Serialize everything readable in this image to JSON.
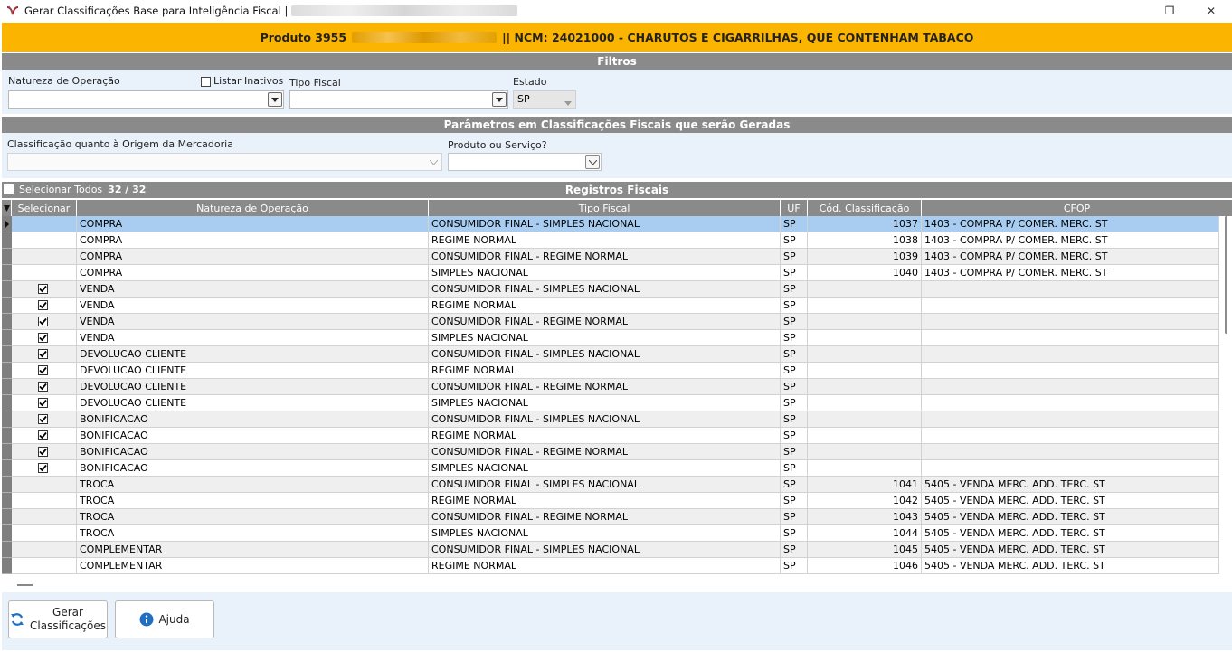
{
  "window": {
    "title": "Gerar Classificações Base para Inteligência Fiscal |",
    "maximize_glyph": "❐",
    "close_glyph": "✕"
  },
  "banner": {
    "product": "Produto 3955",
    "ncm": "|| NCM: 24021000 - CHARUTOS E CIGARRILHAS, QUE CONTENHAM TABACO"
  },
  "filters": {
    "section_title": "Filtros",
    "natureza_label": "Natureza de Operação",
    "listar_inativos_label": "Listar Inativos",
    "tipo_fiscal_label": "Tipo Fiscal",
    "estado_label": "Estado",
    "estado_value": "SP"
  },
  "params": {
    "section_title": "Parâmetros em Classificações Fiscais que serão Geradas",
    "origem_label": "Classificação quanto à Origem da Mercadoria",
    "produto_servico_label": "Produto ou Serviço?"
  },
  "records": {
    "section_title": "Registros Fiscais",
    "select_all_label": "Selecionar Todos",
    "count": "32 / 32"
  },
  "table": {
    "headers": [
      "Selecionar",
      "Natureza de Operação",
      "Tipo Fiscal",
      "UF",
      "Cód. Classificação",
      "CFOP"
    ],
    "rows": [
      {
        "checked": false,
        "natureza": "COMPRA",
        "tipo": "CONSUMIDOR FINAL - SIMPLES NACIONAL",
        "uf": "SP",
        "cod": "1037",
        "cfop": "1403 - COMPRA P/ COMER. MERC. ST"
      },
      {
        "checked": false,
        "natureza": "COMPRA",
        "tipo": "REGIME NORMAL",
        "uf": "SP",
        "cod": "1038",
        "cfop": "1403 - COMPRA P/ COMER. MERC. ST"
      },
      {
        "checked": false,
        "natureza": "COMPRA",
        "tipo": "CONSUMIDOR FINAL - REGIME NORMAL",
        "uf": "SP",
        "cod": "1039",
        "cfop": "1403 - COMPRA P/ COMER. MERC. ST"
      },
      {
        "checked": false,
        "natureza": "COMPRA",
        "tipo": "SIMPLES NACIONAL",
        "uf": "SP",
        "cod": "1040",
        "cfop": "1403 - COMPRA P/ COMER. MERC. ST"
      },
      {
        "checked": true,
        "natureza": "VENDA",
        "tipo": "CONSUMIDOR FINAL - SIMPLES NACIONAL",
        "uf": "SP",
        "cod": "",
        "cfop": ""
      },
      {
        "checked": true,
        "natureza": "VENDA",
        "tipo": "REGIME NORMAL",
        "uf": "SP",
        "cod": "",
        "cfop": ""
      },
      {
        "checked": true,
        "natureza": "VENDA",
        "tipo": "CONSUMIDOR FINAL - REGIME NORMAL",
        "uf": "SP",
        "cod": "",
        "cfop": ""
      },
      {
        "checked": true,
        "natureza": "VENDA",
        "tipo": "SIMPLES NACIONAL",
        "uf": "SP",
        "cod": "",
        "cfop": ""
      },
      {
        "checked": true,
        "natureza": "DEVOLUCAO CLIENTE",
        "tipo": "CONSUMIDOR FINAL - SIMPLES NACIONAL",
        "uf": "SP",
        "cod": "",
        "cfop": ""
      },
      {
        "checked": true,
        "natureza": "DEVOLUCAO CLIENTE",
        "tipo": "REGIME NORMAL",
        "uf": "SP",
        "cod": "",
        "cfop": ""
      },
      {
        "checked": true,
        "natureza": "DEVOLUCAO CLIENTE",
        "tipo": "CONSUMIDOR FINAL - REGIME NORMAL",
        "uf": "SP",
        "cod": "",
        "cfop": ""
      },
      {
        "checked": true,
        "natureza": "DEVOLUCAO CLIENTE",
        "tipo": "SIMPLES NACIONAL",
        "uf": "SP",
        "cod": "",
        "cfop": ""
      },
      {
        "checked": true,
        "natureza": "BONIFICACAO",
        "tipo": "CONSUMIDOR FINAL - SIMPLES NACIONAL",
        "uf": "SP",
        "cod": "",
        "cfop": ""
      },
      {
        "checked": true,
        "natureza": "BONIFICACAO",
        "tipo": "REGIME NORMAL",
        "uf": "SP",
        "cod": "",
        "cfop": ""
      },
      {
        "checked": true,
        "natureza": "BONIFICACAO",
        "tipo": "CONSUMIDOR FINAL - REGIME NORMAL",
        "uf": "SP",
        "cod": "",
        "cfop": ""
      },
      {
        "checked": true,
        "natureza": "BONIFICACAO",
        "tipo": "SIMPLES NACIONAL",
        "uf": "SP",
        "cod": "",
        "cfop": ""
      },
      {
        "checked": false,
        "natureza": "TROCA",
        "tipo": "CONSUMIDOR FINAL - SIMPLES NACIONAL",
        "uf": "SP",
        "cod": "1041",
        "cfop": "5405 - VENDA MERC. ADD. TERC. ST"
      },
      {
        "checked": false,
        "natureza": "TROCA",
        "tipo": "REGIME NORMAL",
        "uf": "SP",
        "cod": "1042",
        "cfop": "5405 - VENDA MERC. ADD. TERC. ST"
      },
      {
        "checked": false,
        "natureza": "TROCA",
        "tipo": "CONSUMIDOR FINAL - REGIME NORMAL",
        "uf": "SP",
        "cod": "1043",
        "cfop": "5405 - VENDA MERC. ADD. TERC. ST"
      },
      {
        "checked": false,
        "natureza": "TROCA",
        "tipo": "SIMPLES NACIONAL",
        "uf": "SP",
        "cod": "1044",
        "cfop": "5405 - VENDA MERC. ADD. TERC. ST"
      },
      {
        "checked": false,
        "natureza": "COMPLEMENTAR",
        "tipo": "CONSUMIDOR FINAL - SIMPLES NACIONAL",
        "uf": "SP",
        "cod": "1045",
        "cfop": "5405 - VENDA MERC. ADD. TERC. ST"
      },
      {
        "checked": false,
        "natureza": "COMPLEMENTAR",
        "tipo": "REGIME NORMAL",
        "uf": "SP",
        "cod": "1046",
        "cfop": "5405 - VENDA MERC. ADD. TERC. ST"
      }
    ]
  },
  "buttons": {
    "gerar_line1": "Gerar",
    "gerar_line2": "Classificações",
    "ajuda": "Ajuda"
  },
  "colors": {
    "banner": "#fbb400",
    "section_header": "#8a8a8a",
    "panel": "#e9f1fb",
    "selected_row": "#a8cdf1",
    "alt_row": "#efefef"
  }
}
